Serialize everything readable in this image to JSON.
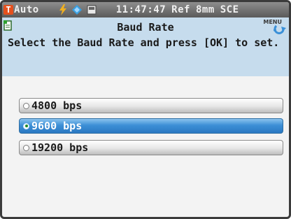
{
  "status_bar": {
    "mode_letter": "T",
    "mode_label": "Auto",
    "time": "11:47:47",
    "ref_label": "Ref",
    "aperture": "8mm",
    "specular": "SCE",
    "icons": [
      "flash-icon",
      "connection-icon",
      "memory-card-icon"
    ]
  },
  "header": {
    "title": "Baud Rate",
    "menu_label": "MENU",
    "instruction": "Select the Baud Rate and press [OK] to set."
  },
  "options": [
    {
      "label": "4800 bps",
      "selected": false
    },
    {
      "label": "9600 bps",
      "selected": true
    },
    {
      "label": "19200 bps",
      "selected": false
    }
  ],
  "colors": {
    "accent_selected": "#2a78c2",
    "header_bg": "#c6dced",
    "status_bar_bg": "#6e6e6e",
    "mode_box": "#e4501e"
  }
}
